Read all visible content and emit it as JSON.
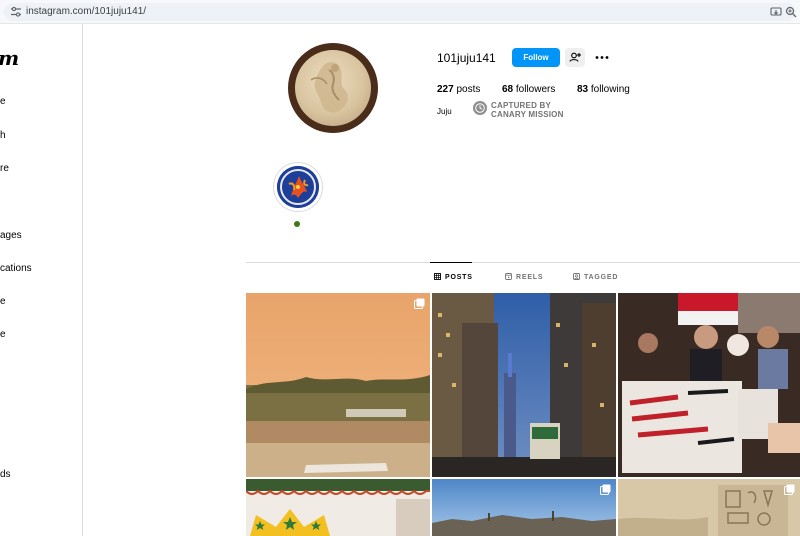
{
  "browser": {
    "url": "instagram.com/101juju141/"
  },
  "sidebar": {
    "logo_fragment": "m",
    "items": [
      {
        "label": "e"
      },
      {
        "label": "h"
      },
      {
        "label": "re"
      },
      {
        "label": "ages"
      },
      {
        "label": "cations"
      },
      {
        "label": "e"
      },
      {
        "label": "e"
      },
      {
        "label": "ds"
      }
    ]
  },
  "profile": {
    "username": "101juju141",
    "follow_label": "Follow",
    "posts_count": "227",
    "posts_label": " posts",
    "followers_count": "68",
    "followers_label": " followers",
    "following_count": "83",
    "following_label": " following",
    "full_name": "Juju",
    "badge_line1": "CAPTURED BY",
    "badge_line2": "CANARY MISSION"
  },
  "tabs": [
    {
      "label": "POSTS",
      "active": true
    },
    {
      "label": "REELS",
      "active": false
    },
    {
      "label": "TAGGED",
      "active": false
    }
  ],
  "posts": [
    {
      "description": "Sunset river with reeds",
      "multiple": true
    },
    {
      "description": "City street at dusk with protest sign",
      "multiple": false
    },
    {
      "description": "Protesters holding Egypt banner",
      "multiple": false
    },
    {
      "description": "Colorful decorated wall",
      "multiple": false
    },
    {
      "description": "Desert landscape",
      "multiple": true
    },
    {
      "description": "Ancient stone hieroglyphs",
      "multiple": true
    }
  ],
  "colors": {
    "accent": "#0095f6",
    "border": "#dbdbdb",
    "text_muted": "#737373"
  }
}
